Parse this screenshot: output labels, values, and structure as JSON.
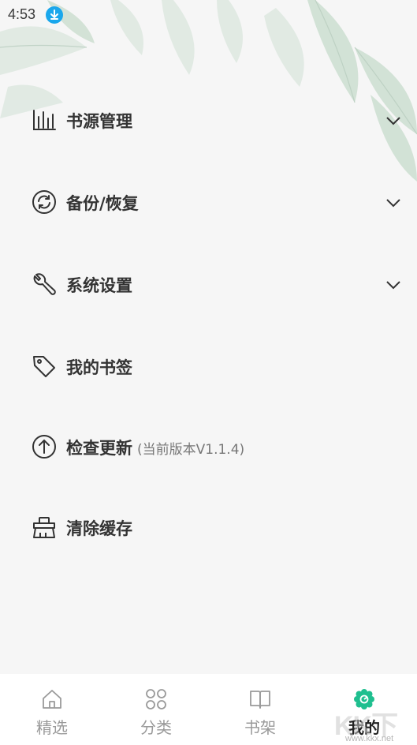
{
  "status_bar": {
    "time": "4:53"
  },
  "menu": {
    "items": [
      {
        "label": "书源管理",
        "icon": "chart-bars-icon",
        "expandable": true
      },
      {
        "label": "备份/恢复",
        "icon": "sync-icon",
        "expandable": true
      },
      {
        "label": "系统设置",
        "icon": "wrench-icon",
        "expandable": true
      },
      {
        "label": "我的书签",
        "icon": "tag-icon",
        "expandable": false
      },
      {
        "label": "检查更新",
        "sub": "(当前版本V1.1.4)",
        "icon": "arrow-up-circle-icon",
        "expandable": false
      },
      {
        "label": "清除缓存",
        "icon": "broom-icon",
        "expandable": false
      }
    ]
  },
  "tabbar": {
    "tabs": [
      {
        "label": "精选",
        "icon": "home-icon",
        "active": false
      },
      {
        "label": "分类",
        "icon": "grid-icon",
        "active": false
      },
      {
        "label": "书架",
        "icon": "book-icon",
        "active": false
      },
      {
        "label": "我的",
        "icon": "flower-icon",
        "active": true
      }
    ]
  },
  "colors": {
    "accent": "#1fbf8f",
    "status_download": "#1aa7ec"
  },
  "watermark": {
    "text": "KK下载",
    "url": "www.kkx.net"
  }
}
